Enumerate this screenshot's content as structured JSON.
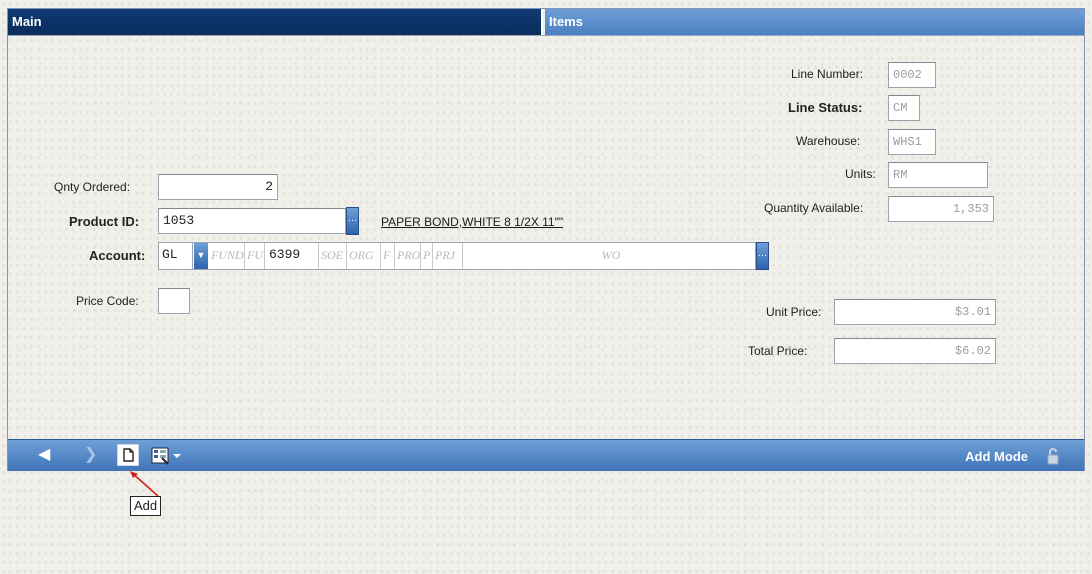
{
  "tabs": {
    "main": "Main",
    "items": "Items"
  },
  "form": {
    "line_number_label": "Line Number:",
    "line_number": "0002",
    "line_status_label": "Line Status:",
    "line_status": "CM",
    "warehouse_label": "Warehouse:",
    "warehouse": "WHS1",
    "units_label": "Units:",
    "units": "RM",
    "qty_available_label": "Quantity Available:",
    "qty_available": "1,353",
    "qty_ordered_label": "Qnty Ordered:",
    "qty_ordered": "2",
    "product_id_label": "Product ID:",
    "product_id": "1053",
    "product_desc": "PAPER BOND,WHITE 8 1/2X 11\"\"",
    "account_label": "Account:",
    "account_type": "GL",
    "account_segments": [
      "FUND",
      "FU",
      "6399",
      "SOE",
      "ORG",
      "F",
      "PRO",
      "P",
      "PRJ",
      "WO"
    ],
    "price_code_label": "Price Code:",
    "price_code": "",
    "unit_price_label": "Unit Price:",
    "unit_price": "$3.01",
    "total_price_label": "Total Price:",
    "total_price": "$6.02"
  },
  "toolbar": {
    "mode": "Add Mode",
    "add_tooltip": "Add"
  },
  "icons": {
    "prev": "left-arrow-icon",
    "next": "right-arrow-icon",
    "new": "new-document-icon",
    "report": "report-menu-icon",
    "lock": "lock-icon"
  },
  "colors": {
    "header_dark": "#0e3b73",
    "header_light": "#5a8ccb",
    "tooltip_arrow": "#d62020"
  }
}
